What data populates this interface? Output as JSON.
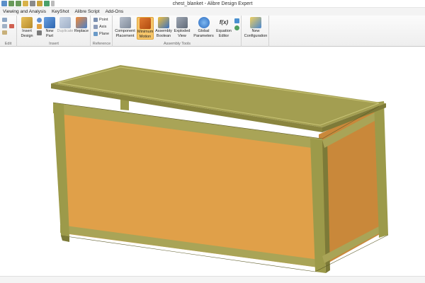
{
  "window": {
    "title": "chest_blanket - Alibre Design Expert"
  },
  "quick_access": {
    "icons": [
      "save-icon",
      "undo-icon",
      "redo-icon",
      "open-icon",
      "print-icon",
      "arrow-icon",
      "refresh-icon",
      "dropdown-icon"
    ]
  },
  "menu": {
    "tabs": [
      "Viewing and Analysis",
      "KeyShot",
      "Alibre Script",
      "Add-Ons"
    ]
  },
  "ribbon": {
    "groups": {
      "edit": "Edit",
      "insert": "Insert",
      "reference": "Reference",
      "assembly_tools": "Assembly Tools"
    },
    "tools": {
      "insert_design": "Insert\nDesign",
      "new_part": "New\nPart",
      "duplicate": "Duplicate",
      "replace": "Replace",
      "point": "Point",
      "axis": "Axis",
      "plane": "Plane",
      "component_placement": "Component\nPlacement",
      "minimum_motion": "Minimum\nMotion",
      "assembly_boolean": "Assembly\nBoolean",
      "exploded_view": "Exploded\nView",
      "global_parameters": "Global\nParameters",
      "equation_editor": "Equation\nEditor",
      "equation_symbol": "f(x)",
      "new_configuration": "New\nConfiguration"
    }
  },
  "colors": {
    "panel_orange": "#E0A049",
    "frame_olive": "#9C9A4A",
    "lid_olive": "#A39E51",
    "active_tool": "#F6C66A"
  }
}
